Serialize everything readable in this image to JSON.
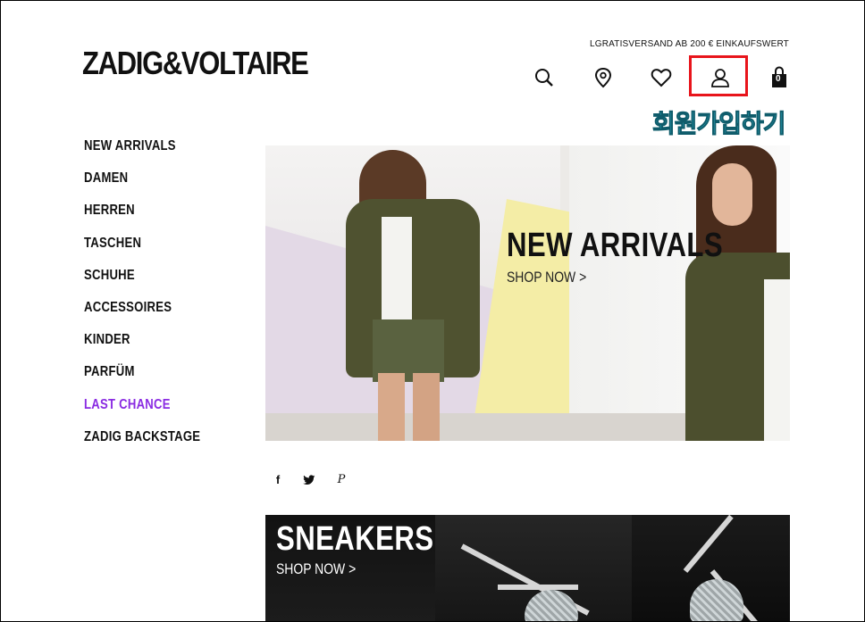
{
  "header": {
    "logo_text": "ZADIG&VOLTAIRE",
    "promo_text": "LGRATISVERSAND AB 200 € EINKAUFSWERT",
    "icons": [
      "search-icon",
      "store-locator-icon",
      "wishlist-heart-icon",
      "account-icon",
      "shopping-bag-icon"
    ],
    "cart_count": "0"
  },
  "annotation": {
    "label": "회원가입하기",
    "highlight_color": "#e8141b",
    "text_color": "#35c1d8"
  },
  "sidebar": {
    "items": [
      {
        "label": "NEW ARRIVALS"
      },
      {
        "label": "DAMEN"
      },
      {
        "label": "HERREN"
      },
      {
        "label": "TASCHEN"
      },
      {
        "label": "SCHUHE"
      },
      {
        "label": "ACCESSOIRES"
      },
      {
        "label": "KINDER"
      },
      {
        "label": "PARFÜM"
      },
      {
        "label": "LAST CHANCE",
        "color": "#8a2be2"
      },
      {
        "label": "ZADIG BACKSTAGE"
      }
    ]
  },
  "hero": {
    "title": "NEW ARRIVALS",
    "cta": "SHOP NOW >"
  },
  "social": {
    "icons": [
      "facebook-icon",
      "twitter-icon",
      "pinterest-icon"
    ],
    "facebook_glyph": "f",
    "pinterest_glyph": "P"
  },
  "banner2": {
    "title": "SNEAKERS",
    "cta": "SHOP NOW >"
  }
}
